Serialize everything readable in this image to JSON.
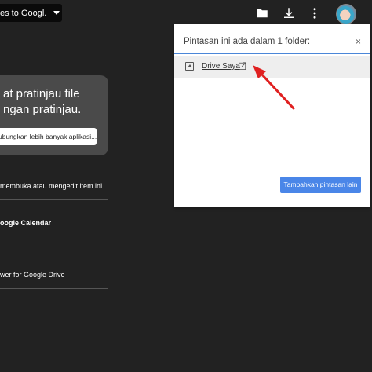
{
  "topbar": {
    "open_with_label": "es to Googl...",
    "icons": [
      "add-to-drive-icon",
      "download-icon",
      "more-vert-icon",
      "avatar"
    ]
  },
  "preview_card": {
    "line1": "at pratinjau file",
    "line2": "ngan pratinjau.",
    "button_label": "ubungkan lebih banyak aplikasi..."
  },
  "left_list": {
    "item1": "membuka atau mengedit item ini",
    "item2": "oogle Calendar",
    "item3": "wer for Google Drive"
  },
  "panel": {
    "title": "Pintasan ini ada dalam 1 folder:",
    "close_label": "×",
    "folder_name": "Drive Saya",
    "add_shortcut_label": "Tambahkan pintasan lain"
  },
  "colors": {
    "accent": "#4a86e8",
    "annotation_arrow": "#e02020"
  }
}
